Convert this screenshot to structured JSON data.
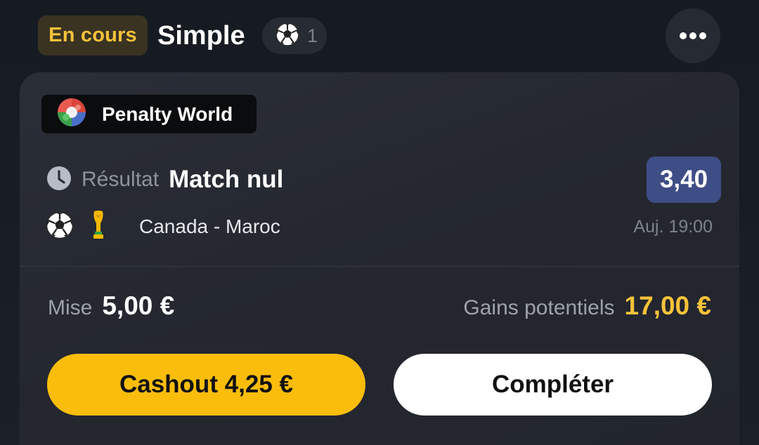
{
  "header": {
    "status": "En cours",
    "bet_type": "Simple",
    "sport_icon": "soccer-ball-icon",
    "selection_count": "1",
    "more_icon": "more-dots-icon"
  },
  "card": {
    "competition": {
      "icon": "penalty-world-logo",
      "label": "Penalty World"
    },
    "market": {
      "icon": "clock-icon",
      "type": "Résultat",
      "selection": "Match nul",
      "odds": "3,40"
    },
    "event": {
      "sport_icon": "soccer-ball-icon",
      "competition_icon": "trophy-icon",
      "name": "Canada - Maroc",
      "time": "Auj. 19:00"
    },
    "stake": {
      "label": "Mise",
      "value": "5,00 €"
    },
    "potential_winnings": {
      "label": "Gains potentiels",
      "value": "17,00 €"
    },
    "buttons": {
      "cashout": "Cashout 4,25 €",
      "complete": "Compléter"
    }
  },
  "colors": {
    "accent_yellow": "#fbbd0c",
    "gains_yellow": "#f6c23a",
    "odds_blue": "#3f4d86",
    "background": "#1b1f27"
  }
}
